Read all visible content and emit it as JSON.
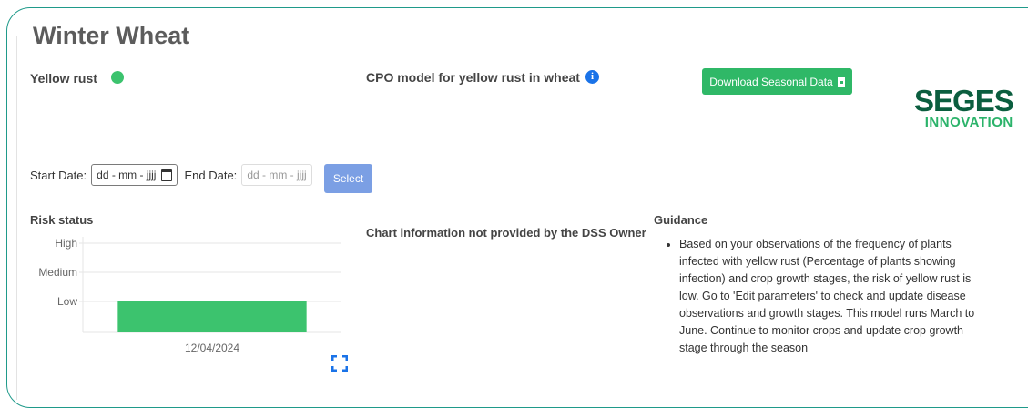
{
  "page": {
    "title": "Winter Wheat"
  },
  "disease": {
    "name": "Yellow rust",
    "status_color": "#3cc36e"
  },
  "model": {
    "title": "CPO model for yellow rust in wheat",
    "info_icon": "info-circle-icon"
  },
  "download": {
    "label": "Download Seasonal Data",
    "icon": "file-download-icon"
  },
  "logo": {
    "line1": "SEGES",
    "line2": "INNOVATION"
  },
  "dates": {
    "start_label": "Start Date:",
    "start_placeholder": "dd - mm - jjjj",
    "end_label": "End Date:",
    "end_placeholder": "dd - mm - jjjj",
    "select_label": "Select"
  },
  "risk": {
    "title": "Risk status"
  },
  "chart_info": {
    "text": "Chart information not provided by the DSS Owner"
  },
  "guidance": {
    "title": "Guidance",
    "items": [
      "Based on your observations of the frequency of plants infected with yellow rust (Percentage of plants showing infection) and crop growth stages, the risk of yellow rust is low. Go to 'Edit parameters' to check and update disease observations and growth stages. This model runs March to June. Continue to monitor crops and update crop growth stage through the season"
    ]
  },
  "chart_data": {
    "type": "bar",
    "categories": [
      "12/04/2024"
    ],
    "values": [
      "Low"
    ],
    "y_categories": [
      "Low",
      "Medium",
      "High"
    ],
    "color": "#3cc36e",
    "grid": true
  },
  "colors": {
    "accent": "#2fb867",
    "select_button": "#7b9fe4",
    "frame": "#1f9a8a"
  }
}
